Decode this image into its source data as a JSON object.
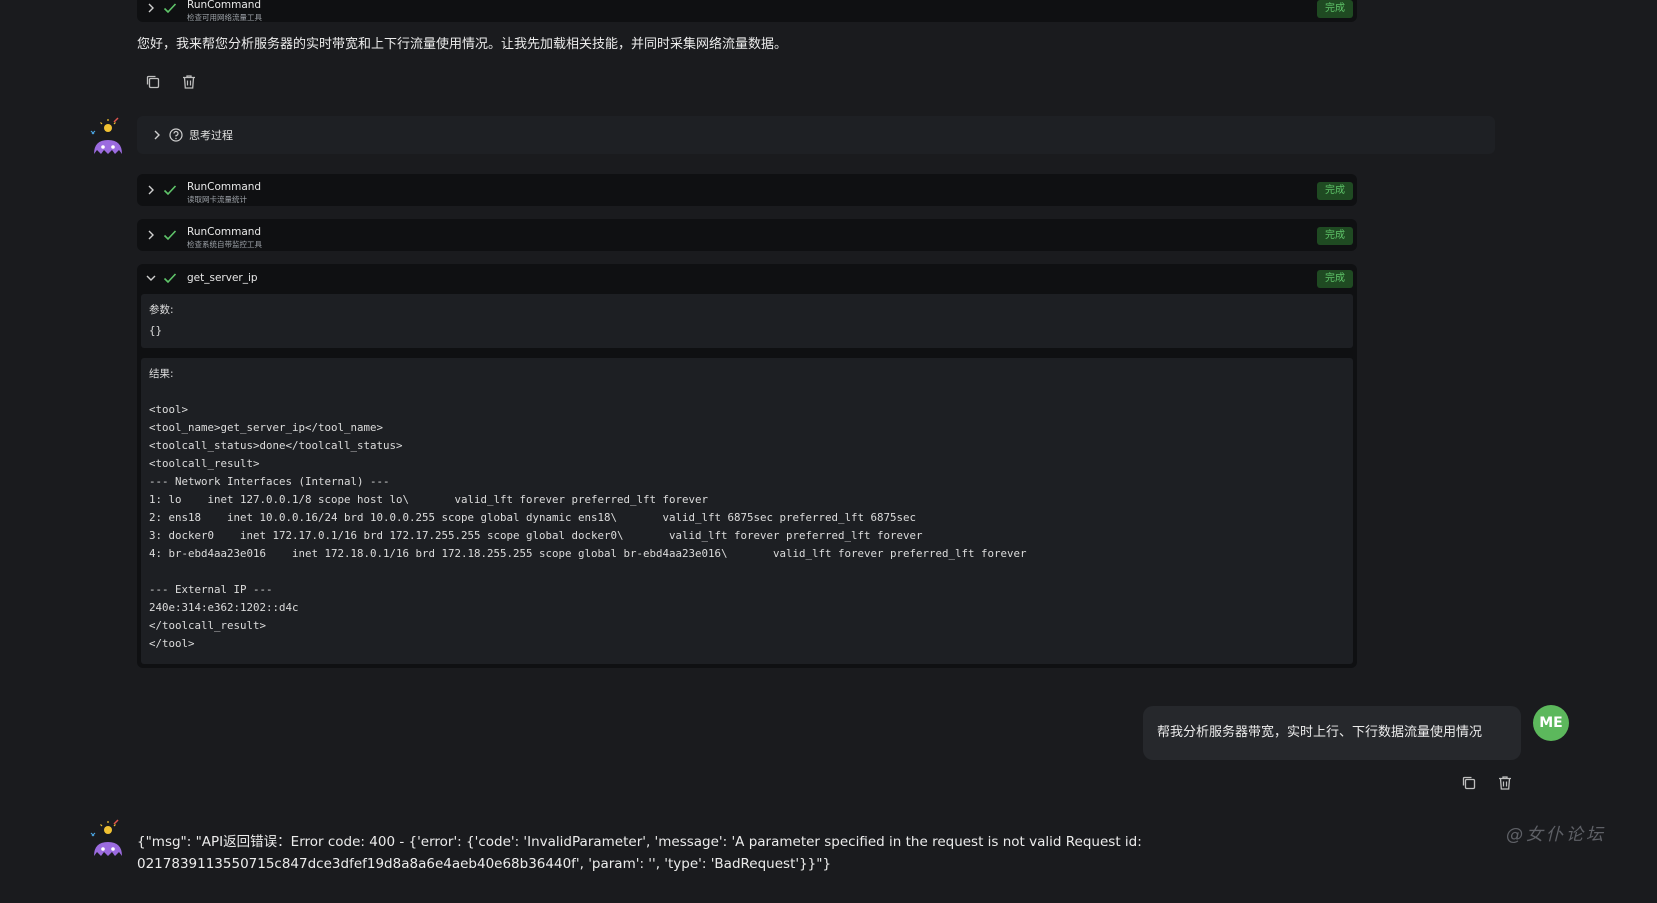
{
  "top_tool": {
    "name": "RunCommand",
    "desc": "检查可用网络流量工具",
    "status": "完成"
  },
  "assistant_intro": "您好，我来帮您分析服务器的实时带宽和上下行流量使用情况。让我先加载相关技能，并同时采集网络流量数据。",
  "thinking_label": "思考过程",
  "tools": [
    {
      "name": "RunCommand",
      "desc": "读取网卡流量统计",
      "status": "完成"
    },
    {
      "name": "RunCommand",
      "desc": "检查系统自带监控工具",
      "status": "完成"
    },
    {
      "name": "get_server_ip",
      "desc": "",
      "status": "完成"
    }
  ],
  "expanded_tool": {
    "params_label": "参数:",
    "params_value": "{}",
    "result_label": "结果:",
    "result_lines": [
      "",
      "<tool>",
      "<tool_name>get_server_ip</tool_name>",
      "<toolcall_status>done</toolcall_status>",
      "<toolcall_result>",
      "--- Network Interfaces (Internal) ---",
      "1: lo    inet 127.0.0.1/8 scope host lo\\       valid_lft forever preferred_lft forever",
      "2: ens18    inet 10.0.0.16/24 brd 10.0.0.255 scope global dynamic ens18\\       valid_lft 6875sec preferred_lft 6875sec",
      "3: docker0    inet 172.17.0.1/16 brd 172.17.255.255 scope global docker0\\       valid_lft forever preferred_lft forever",
      "4: br-ebd4aa23e016    inet 172.18.0.1/16 brd 172.18.255.255 scope global br-ebd4aa23e016\\       valid_lft forever preferred_lft forever",
      "",
      "--- External IP ---",
      "240e:314:e362:1202::d4c",
      "</toolcall_result>",
      "</tool>"
    ]
  },
  "user_message": "帮我分析服务器带宽，实时上行、下行数据流量使用情况",
  "user_avatar": "ME",
  "error_line1": "{\"msg\": \"API返回错误：Error code: 400 - {'error': {'code': 'InvalidParameter', 'message': 'A parameter specified in the request is not valid Request id:",
  "error_line2": "0217839113550715c847dce3dfef19d8a8a6e4aeb40e68b36440f', 'param': '', 'type': 'BadRequest'}}\"}",
  "watermark": "@女仆论坛",
  "colors": {
    "background": "#1a1b1e",
    "card": "#0f1012",
    "badge_bg": "#1f4a22",
    "badge_fg": "#5fc56a",
    "user_avatar": "#5cb85c"
  }
}
